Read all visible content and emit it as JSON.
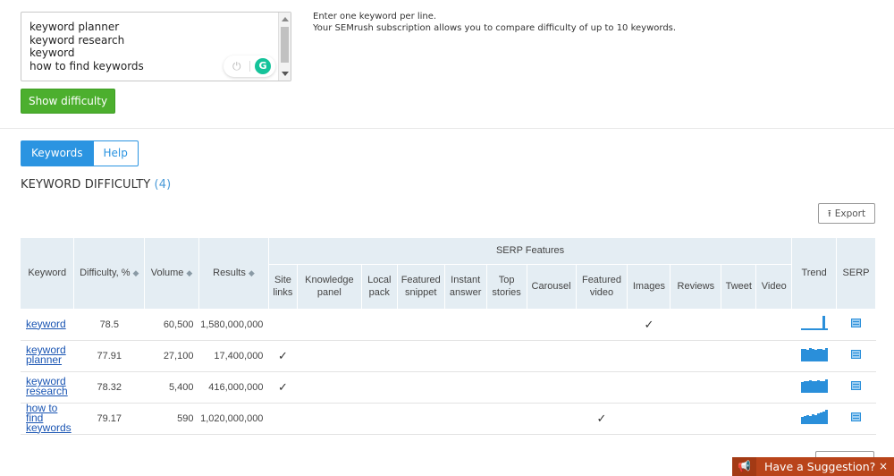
{
  "keywords_input": {
    "lines": [
      "keyword planner",
      "keyword research",
      "keyword",
      "how to find keywords"
    ]
  },
  "hint": {
    "line1": "Enter one keyword per line.",
    "line2": "Your SEMrush subscription allows you to compare difficulty of up to 10 keywords."
  },
  "show_button": "Show difficulty",
  "tabs": [
    {
      "label": "Keywords",
      "active": true
    },
    {
      "label": "Help",
      "active": false
    }
  ],
  "section": {
    "title": "KEYWORD DIFFICULTY",
    "count": "(4)"
  },
  "export_label": "Export",
  "table": {
    "group_header": "SERP Features",
    "headers": {
      "keyword": "Keyword",
      "difficulty": "Difficulty, %",
      "volume": "Volume",
      "results": "Results",
      "trend": "Trend",
      "serp": "SERP"
    },
    "features": [
      [
        "Site",
        "links"
      ],
      [
        "Knowledge",
        "panel"
      ],
      [
        "Local",
        "pack"
      ],
      [
        "Featured",
        "snippet"
      ],
      [
        "Instant",
        "answer"
      ],
      [
        "Top",
        "stories"
      ],
      [
        "Carousel"
      ],
      [
        "Featured",
        "video"
      ],
      [
        "Images"
      ],
      [
        "Reviews"
      ],
      [
        "Tweet"
      ],
      [
        "Video"
      ]
    ],
    "rows": [
      {
        "keyword": [
          "keyword"
        ],
        "difficulty": "78.5",
        "volume": "60,500",
        "results": "1,580,000,000",
        "features": [
          0,
          0,
          0,
          0,
          0,
          0,
          0,
          0,
          1,
          0,
          0,
          0
        ],
        "trend": [
          0.1,
          0.1,
          0.1,
          0.1,
          0.1,
          0.1,
          0.1,
          0.1,
          1.0,
          0.1
        ]
      },
      {
        "keyword": [
          "keyword",
          "planner"
        ],
        "difficulty": "77.91",
        "volume": "27,100",
        "results": "17,400,000",
        "features": [
          1,
          0,
          0,
          0,
          0,
          0,
          0,
          0,
          0,
          0,
          0,
          0
        ],
        "trend": [
          0.85,
          0.9,
          0.8,
          0.95,
          0.85,
          0.8,
          0.9,
          0.85,
          0.8,
          0.95
        ]
      },
      {
        "keyword": [
          "keyword",
          "research"
        ],
        "difficulty": "78.32",
        "volume": "5,400",
        "results": "416,000,000",
        "features": [
          1,
          0,
          0,
          0,
          0,
          0,
          0,
          0,
          0,
          0,
          0,
          0
        ],
        "trend": [
          0.75,
          0.8,
          0.8,
          0.85,
          0.8,
          0.8,
          0.85,
          0.8,
          0.8,
          0.95
        ]
      },
      {
        "keyword": [
          "how to",
          "find",
          "keywords"
        ],
        "difficulty": "79.17",
        "volume": "590",
        "results": "1,020,000,000",
        "features": [
          0,
          0,
          0,
          0,
          0,
          0,
          0,
          1,
          0,
          0,
          0,
          0
        ],
        "trend": [
          0.5,
          0.55,
          0.6,
          0.55,
          0.7,
          0.6,
          0.75,
          0.8,
          0.9,
          1.0
        ]
      }
    ]
  },
  "suggestion": {
    "label": "Have a Suggestion?",
    "close": "×"
  },
  "icons": {
    "grammarly_logo": "G",
    "power": "⏻",
    "check": "✓",
    "megaphone": "📢",
    "upload": "⭱"
  },
  "colors": {
    "accent_blue": "#2b94e1",
    "green": "#4caf2e",
    "trend_blue": "#2a8fda",
    "header_bg": "#e4edf3",
    "suggest_bg": "#b9441a"
  }
}
